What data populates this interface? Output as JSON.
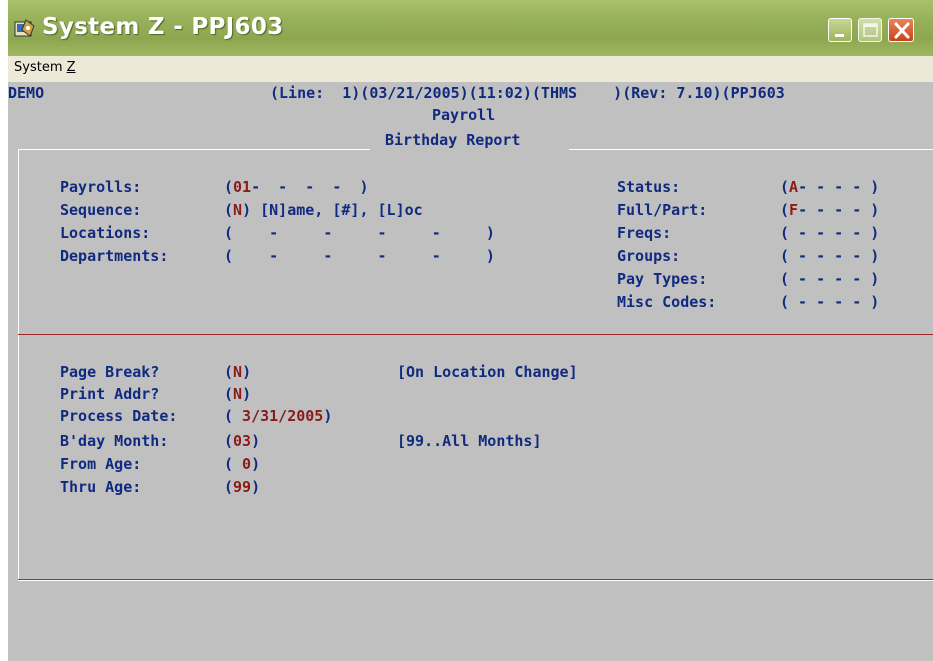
{
  "window": {
    "title": "System Z - PPJ603",
    "buttons": [
      "minimize",
      "maximize",
      "close"
    ]
  },
  "menu": {
    "items": [
      {
        "label": "System Z",
        "prefix": "System ",
        "mnemonic": "Z"
      }
    ]
  },
  "header": {
    "company": "DEMO",
    "line_info": "(Line:  1)(03/21/2005)(11:02)(THMS    )(Rev: 7.10)(PPJ603",
    "module": "Payroll",
    "report": "Birthday Report"
  },
  "selection": {
    "payrolls": {
      "label": "Payrolls:",
      "open": "(",
      "value": "01",
      "rest": "-  -  -  -  )"
    },
    "sequence": {
      "label": "Sequence:",
      "open": "(",
      "value": "N",
      "rest": ") [N]ame, [#], [L]oc"
    },
    "locations": {
      "label": "Locations:",
      "value": "(    -     -     -     -     )"
    },
    "departments": {
      "label": "Departments:",
      "value": "(    -     -     -     -     )"
    },
    "status": {
      "label": "Status:",
      "open": "(",
      "value": "A",
      "rest": "- - - - )"
    },
    "full_part": {
      "label": "Full/Part:",
      "open": "(",
      "value": "F",
      "rest": "- - - - )"
    },
    "freqs": {
      "label": "Freqs:",
      "value": "( - - - - )"
    },
    "groups": {
      "label": "Groups:",
      "value": "( - - - - )"
    },
    "pay_types": {
      "label": "Pay Types:",
      "value": "( - - - - )"
    },
    "misc_codes": {
      "label": "Misc Codes:",
      "value": "( - - - - )"
    }
  },
  "options": {
    "page_break": {
      "label": "Page Break?",
      "open": "(",
      "value": "N",
      "close": ")",
      "hint": "[On Location Change]"
    },
    "print_addr": {
      "label": "Print Addr?",
      "open": "(",
      "value": "N",
      "close": ")"
    },
    "process_date": {
      "label": "Process Date:",
      "open": "(",
      "value": " 3/31/2005",
      "close": ")"
    },
    "bday_month": {
      "label": "B'day Month:",
      "open": "(",
      "value": "03",
      "close": ")",
      "hint": "[99..All Months]"
    },
    "from_age": {
      "label": "From Age:",
      "open": "(",
      "value": " 0",
      "close": ")"
    },
    "thru_age": {
      "label": "Thru Age:",
      "open": "(",
      "value": "99",
      "close": ")"
    }
  },
  "colors": {
    "text": "#102a80",
    "value": "#8b1a1a",
    "background": "#c0c0c0",
    "titlebar": "#97b05a"
  }
}
